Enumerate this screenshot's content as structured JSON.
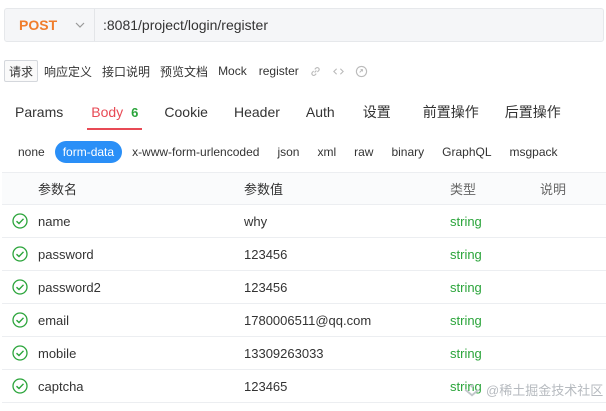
{
  "request": {
    "method": "POST",
    "url": ":8081/project/login/register"
  },
  "subtabs": [
    {
      "label": "请求",
      "active": true
    },
    {
      "label": "响应定义",
      "active": false
    },
    {
      "label": "接口说明",
      "active": false
    },
    {
      "label": "预览文档",
      "active": false
    },
    {
      "label": "Mock",
      "active": false
    }
  ],
  "api_name": "register",
  "tabs": [
    {
      "label": "Params",
      "badge": ""
    },
    {
      "label": "Body",
      "badge": "6"
    },
    {
      "label": "Cookie",
      "badge": ""
    },
    {
      "label": "Header",
      "badge": ""
    },
    {
      "label": "Auth",
      "badge": ""
    },
    {
      "label": "设置",
      "badge": ""
    },
    {
      "label": "前置操作",
      "badge": ""
    },
    {
      "label": "后置操作",
      "badge": ""
    }
  ],
  "active_tab": "Body",
  "body_types": [
    "none",
    "form-data",
    "x-www-form-urlencoded",
    "json",
    "xml",
    "raw",
    "binary",
    "GraphQL",
    "msgpack"
  ],
  "active_body_type": "form-data",
  "table": {
    "headers": {
      "name": "参数名",
      "value": "参数值",
      "type": "类型",
      "desc": "说明"
    },
    "rows": [
      {
        "name": "name",
        "value": "why",
        "type": "string",
        "desc": ""
      },
      {
        "name": "password",
        "value": "123456",
        "type": "string",
        "desc": ""
      },
      {
        "name": "password2",
        "value": "123456",
        "type": "string",
        "desc": ""
      },
      {
        "name": "email",
        "value": "1780006511@qq.com",
        "type": "string",
        "desc": ""
      },
      {
        "name": "mobile",
        "value": "13309263033",
        "type": "string",
        "desc": ""
      },
      {
        "name": "captcha",
        "value": "123465",
        "type": "string",
        "desc": ""
      }
    ]
  },
  "watermark": "@稀土掘金技术社区",
  "colors": {
    "method": "#f07d2c",
    "active_tab": "#e84a55",
    "badge": "#2aa43a",
    "type": "#2aa43a",
    "pill": "#2a8ff7"
  }
}
